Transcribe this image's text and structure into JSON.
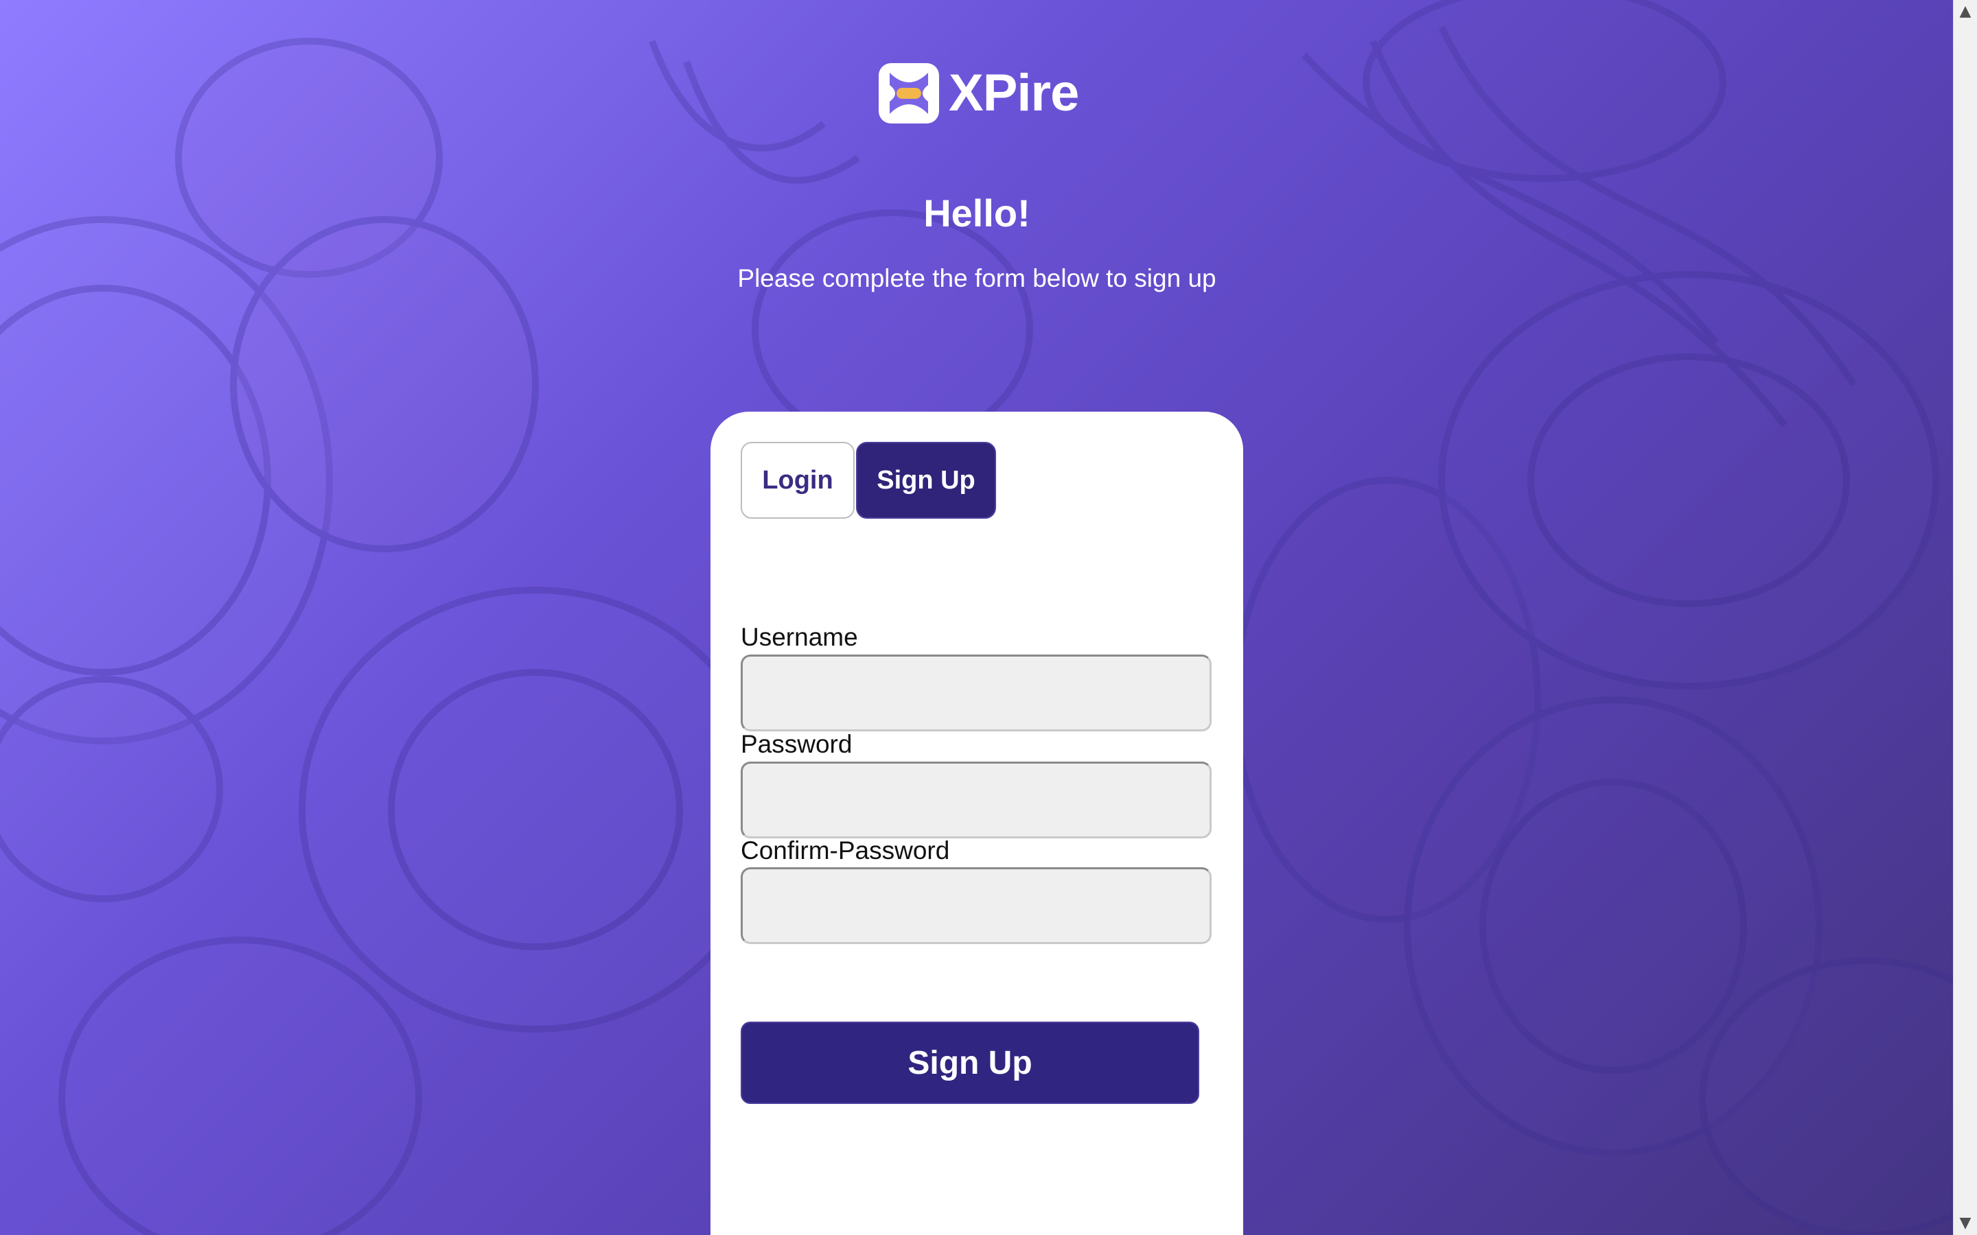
{
  "brand": {
    "name": "XPire",
    "logo_icon": "xpire-logo-icon"
  },
  "hero": {
    "title": "Hello!",
    "subtitle": "Please complete the form below to sign up"
  },
  "tabs": [
    {
      "label": "Login",
      "active": false
    },
    {
      "label": "Sign Up",
      "active": true
    }
  ],
  "form": {
    "fields": [
      {
        "label": "Username",
        "value": "",
        "type": "text"
      },
      {
        "label": "Password",
        "value": "",
        "type": "password"
      },
      {
        "label": "Confirm-Password",
        "value": "",
        "type": "password"
      }
    ],
    "submit_label": "Sign Up"
  },
  "scrollbar": {
    "up_icon": "chevron-up-icon",
    "down_icon": "chevron-down-icon"
  },
  "colors": {
    "primary": "#302580",
    "background_start": "#8f7cff",
    "background_end": "#43337f",
    "card": "#ffffff"
  }
}
